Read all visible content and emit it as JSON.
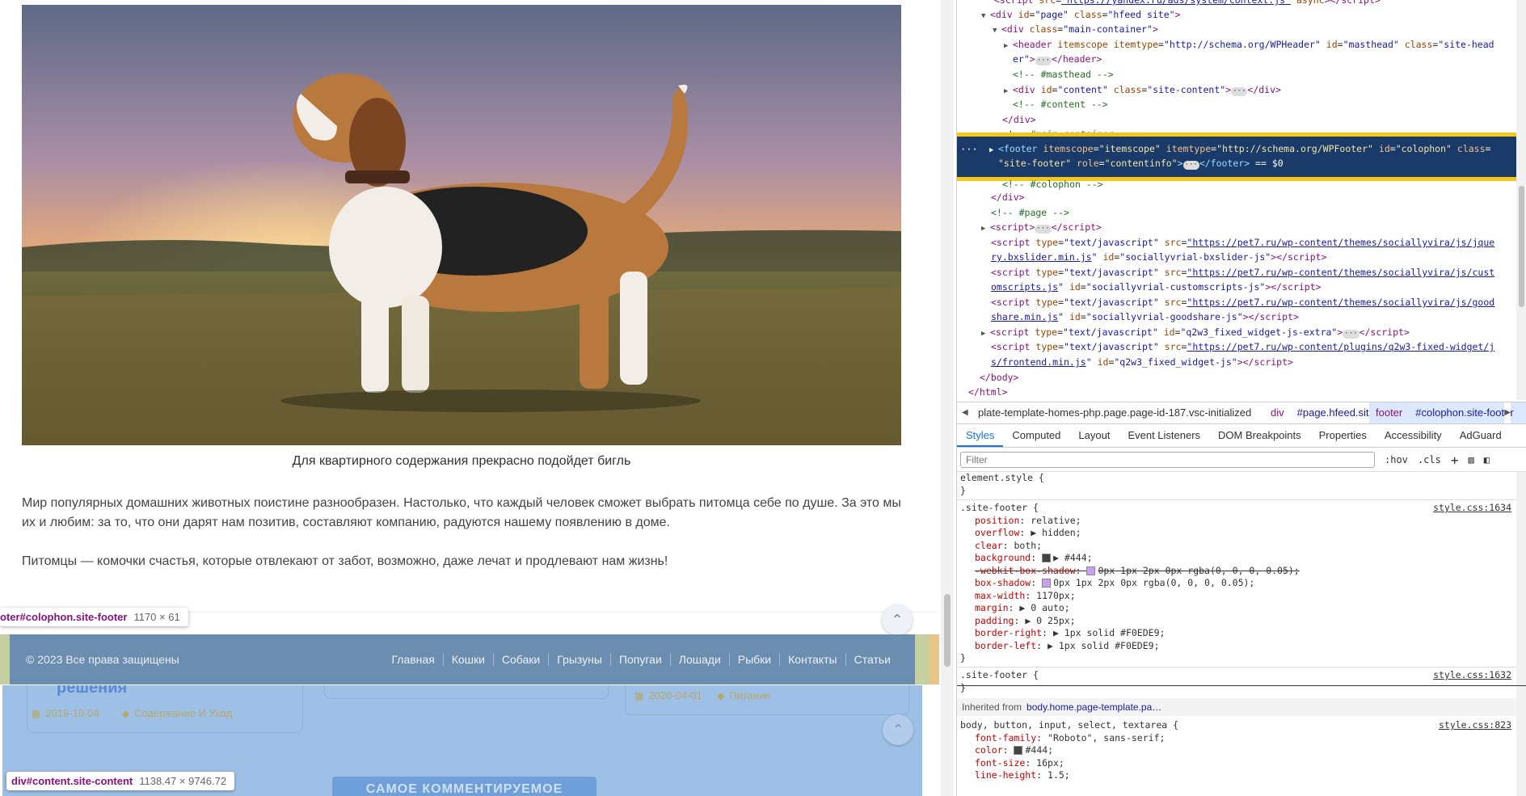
{
  "page": {
    "caption": "Для квартирного содержания прекрасно подойдет бигль",
    "paragraph1": "Мир популярных домашних животных поистине разнообразен. Настолько, что каждый человек сможет выбрать питомца себе по душе. За это мы их и любим: за то, что они дарят нам позитив, составляют компанию, радуются нашему появлению в доме.",
    "paragraph2": "Питомцы — комочки счастья, которые отвлекают от забот, возможно, даже лечат и продлевают нам жизнь!",
    "tooltip_footer": {
      "selector": "oter#colophon.site-footer",
      "size": "1170 × 61"
    },
    "tooltip_content": {
      "selector": "div#content.site-content",
      "size": "1138.47 × 9746.72"
    },
    "footer": {
      "copyright": "© 2023 Все права защищены",
      "menu": [
        "Главная",
        "Кошки",
        "Собаки",
        "Грызуны",
        "Попугаи",
        "Лошади",
        "Рыбки",
        "Контакты",
        "Статьи"
      ]
    },
    "behind": {
      "card_title": "решения",
      "date1": "2019-10-04",
      "tag1": "Содержание И Уход",
      "date2": "2020-04-01",
      "tag2": "Питание",
      "button": "САМОЕ КОММЕНТИРУЕМОЕ"
    }
  },
  "devtools": {
    "breadcrumb": {
      "item1": "plate-template-homes-php.page.page-id-187.vsc-initialized",
      "item2_tag": "div",
      "item2_id": "#page.hfeed.site",
      "item3_tag": "footer",
      "item3_id": "#colophon.site-footer"
    },
    "tabs": [
      "Styles",
      "Computed",
      "Layout",
      "Event Listeners",
      "DOM Breakpoints",
      "Properties",
      "Accessibility",
      "AdGuard"
    ],
    "filter_placeholder": "Filter",
    "hov": ":hov",
    "cls": ".cls",
    "plus": "+",
    "styles": {
      "element_style": "element.style {",
      "close": "}",
      "rule1_selector": ".site-footer {",
      "rule1_source": "style.css:1634",
      "rule1_props": [
        {
          "p": "position",
          "v": "relative;"
        },
        {
          "p": "overflow",
          "v": "▶ hidden;"
        },
        {
          "p": "clear",
          "v": "both;"
        },
        {
          "p": "background",
          "v": "▶ #444;"
        },
        {
          "p": "-webkit-box-shadow",
          "v": "0px 1px 2px 0px rgba(0, 0, 0, 0.05);"
        },
        {
          "p": "box-shadow",
          "v": "0px 1px 2px 0px rgba(0, 0, 0, 0.05);"
        },
        {
          "p": "max-width",
          "v": "1170px;"
        },
        {
          "p": "margin",
          "v": "▶ 0 auto;"
        },
        {
          "p": "padding",
          "v": "▶ 0 25px;"
        },
        {
          "p": "border-right",
          "v": "▶ 1px solid #F0EDE9;"
        },
        {
          "p": "border-left",
          "v": "▶ 1px solid #F0EDE9;"
        }
      ],
      "rule2_selector": ".site-footer {",
      "rule2_source": "style.css:1632",
      "inherited_label": "Inherited from",
      "inherited_link": "body.home.page-template.pa…",
      "rule3_selector": "body, button, input, select, textarea {",
      "rule3_source": "style.css:823",
      "rule3_props": [
        {
          "p": "font-family",
          "v": "\"Roboto\", sans-serif;"
        },
        {
          "p": "color",
          "v": "#444;"
        },
        {
          "p": "font-size",
          "v": "16px;"
        },
        {
          "p": "line-height",
          "v": "1.5;"
        }
      ]
    }
  }
}
